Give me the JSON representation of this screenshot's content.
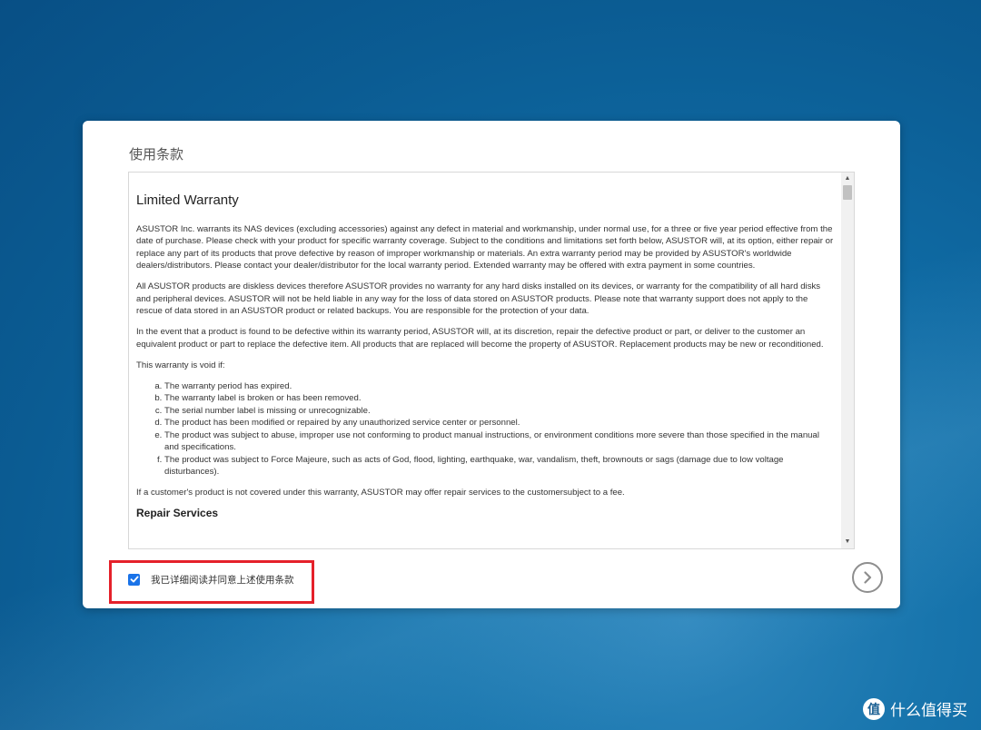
{
  "dialog": {
    "title": "使用条款",
    "terms": {
      "heading": "Limited Warranty",
      "paragraphs": [
        "ASUSTOR Inc. warrants its NAS devices (excluding accessories) against any defect in material and workmanship, under normal use, for a three or five year period effective from the date of purchase. Please check with your product for specific warranty coverage. Subject to the conditions and limitations set forth below, ASUSTOR will, at its option, either repair or replace any part of its products that prove defective by reason of improper workmanship or materials. An extra warranty period may be provided by ASUSTOR's worldwide dealers/distributors. Please contact your dealer/distributor for the local warranty period. Extended warranty may be offered with extra payment in some countries.",
        "All ASUSTOR products are diskless devices therefore ASUSTOR provides no warranty for any hard disks installed on its devices, or warranty for the compatibility of all hard disks and peripheral devices. ASUSTOR will not be held liable in any way for the loss of data stored on ASUSTOR products. Please note that warranty support does not apply to the rescue of data stored in an ASUSTOR product or related backups. You are responsible for the protection of your data.",
        "In the event that a product is found to be defective within its warranty period, ASUSTOR will, at its discretion, repair the defective product or part, or deliver to the customer an equivalent product or part to replace the defective item. All products that are replaced will become the property of ASUSTOR. Replacement products may be new or reconditioned.",
        "This warranty is void if:"
      ],
      "void_list": [
        "The warranty period has expired.",
        "The warranty label is broken or has been removed.",
        "The serial number label is missing or unrecognizable.",
        "The product has been modified or repaired by any unauthorized service center or personnel.",
        "The product was subject to abuse, improper use not conforming to product manual instructions, or environment conditions more severe than those specified in the manual and specifications.",
        "The product was subject to Force Majeure, such as acts of God, flood, lighting, earthquake, war, vandalism, theft, brownouts or sags (damage due to low voltage disturbances)."
      ],
      "closing": "If a customer's product is not covered under this warranty, ASUSTOR may offer repair services to the customersubject to a fee.",
      "next_heading_partial": "Repair Services"
    },
    "agree": {
      "checked": true,
      "label": "我已详细阅读并同意上述使用条款"
    },
    "next_icon": "chevron-right-circle-icon"
  },
  "watermark": {
    "logo_glyph": "值",
    "text": "什么值得买"
  },
  "colors": {
    "accent": "#1a73e8",
    "highlight": "#e5212a"
  }
}
